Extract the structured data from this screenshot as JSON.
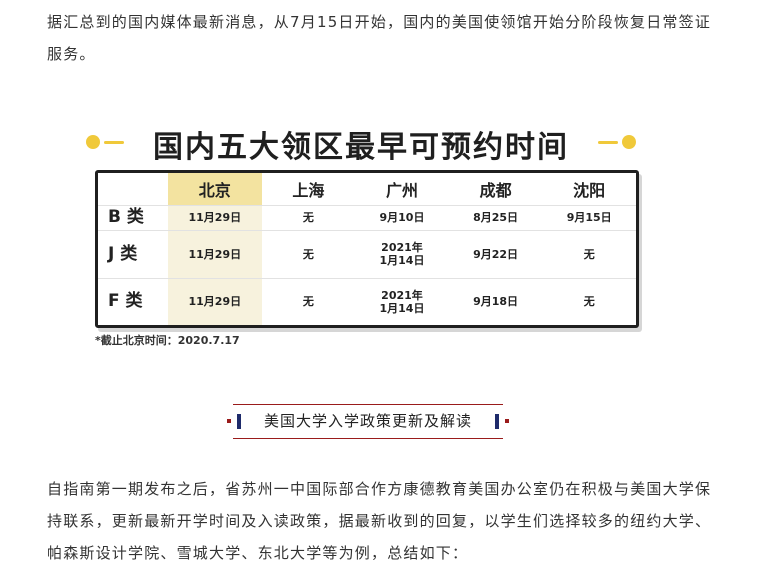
{
  "intro_paragraph": "据汇总到的国内媒体最新消息，从7月15日开始，国内的美国使领馆开始分阶段恢复日常签证服务。",
  "figure": {
    "title": "国内五大领区最早可预约时间",
    "columns": [
      "",
      "北京",
      "上海",
      "广州",
      "成都",
      "沈阳"
    ],
    "rows": [
      {
        "label": "B 类",
        "cells": [
          "11月29日",
          "无",
          "9月10日",
          "8月25日",
          "9月15日"
        ]
      },
      {
        "label": "J 类",
        "cells": [
          "11月29日",
          "无",
          "2021年\n1月14日",
          "9月22日",
          "无"
        ]
      },
      {
        "label": "F 类",
        "cells": [
          "11月29日",
          "无",
          "2021年\n1月14日",
          "9月18日",
          "无"
        ]
      }
    ],
    "footnote": "*截止北京时间：2020.7.17",
    "accent_color": "#f0c93a"
  },
  "section_heading": "美国大学入学政策更新及解读",
  "body_paragraph": "自指南第一期发布之后，省苏州一中国际部合作方康德教育美国办公室仍在积极与美国大学保持联系，更新最新开学时间及入读政策，据最新收到的回复，以学生们选择较多的纽约大学、帕森斯设计学院、雪城大学、东北大学等为例，总结如下："
}
